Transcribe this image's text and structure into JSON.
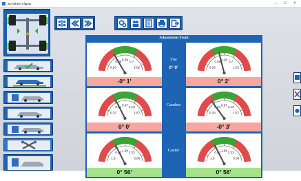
{
  "window": {
    "title": "3D Wheel Aligner",
    "min_icon": "minimize-icon",
    "max_icon": "maximize-icon",
    "close_icon": "close-icon"
  },
  "toolbar_left": [
    {
      "name": "car-view-button",
      "icon": "car-axle-icon"
    },
    {
      "name": "back-button",
      "icon": "double-chevron-left-icon"
    },
    {
      "name": "forward-button",
      "icon": "double-chevron-right-icon"
    }
  ],
  "toolbar_right": [
    {
      "name": "settings-button",
      "icon": "gears-icon"
    },
    {
      "name": "customers-button",
      "icon": "users-icon"
    },
    {
      "name": "report-button",
      "icon": "document-icon"
    },
    {
      "name": "print-button",
      "icon": "printer-icon"
    },
    {
      "name": "exit-button",
      "icon": "exit-icon"
    }
  ],
  "panel": {
    "title": "Adjustment Front",
    "rows": [
      {
        "label": "Toe",
        "value_center": "0° 0'",
        "left": {
          "ticks": [
            "0.26",
            "0.06",
            "0.38",
            "0.7",
            "1.02"
          ],
          "value": "-0° 1'",
          "status": "red",
          "needle": 0.33
        },
        "right": {
          "ticks": [
            "0.26",
            "0.06",
            "0.38",
            "0.7",
            "1.02"
          ],
          "value": "0° 2'",
          "status": "red",
          "needle": 0.42
        }
      },
      {
        "label": "Camber",
        "value_center": "",
        "left": {
          "ticks": [
            "0.33",
            "0.21",
            "0.67",
            "1.13",
            "1.67"
          ],
          "value": "0° 0'",
          "status": "red",
          "needle": 0.35
        },
        "right": {
          "ticks": [
            "0.33",
            "0.21",
            "0.67",
            "1.13",
            "1.67"
          ],
          "value": "-0° 3'",
          "status": "red",
          "needle": 0.3
        }
      },
      {
        "label": "Caster",
        "value_center": "",
        "left": {
          "ticks": [
            "1.5",
            "0.83",
            "1.58",
            "2.33",
            "3.08"
          ],
          "value": "0° 56'",
          "status": "green",
          "needle": 0.35
        },
        "right": {
          "ticks": [
            "1.5",
            "0.83",
            "1.58",
            "2.33",
            "3.08"
          ],
          "value": "0° 56'",
          "status": "green",
          "needle": 0.35
        }
      }
    ]
  },
  "nav_items": [
    {
      "name": "nav-vehicle-check",
      "icon": "car-check-icon"
    },
    {
      "name": "nav-vehicle-lift",
      "icon": "car-lift-icon"
    },
    {
      "name": "nav-vehicle-measure",
      "icon": "car-measure-icon"
    },
    {
      "name": "nav-vehicle-runout",
      "icon": "car-runout-icon"
    },
    {
      "name": "nav-vehicle-steer",
      "icon": "car-steer-icon"
    },
    {
      "name": "nav-vehicle-adjust",
      "icon": "wrench-tool-icon"
    },
    {
      "name": "nav-vehicle-report",
      "icon": "car-report-icon"
    }
  ],
  "colors": {
    "accent": "#1d64b5",
    "red_zone": "#e04a4a",
    "green_zone": "#39a535",
    "value_red": "#f7a6a0",
    "value_green": "#a6e28d"
  }
}
